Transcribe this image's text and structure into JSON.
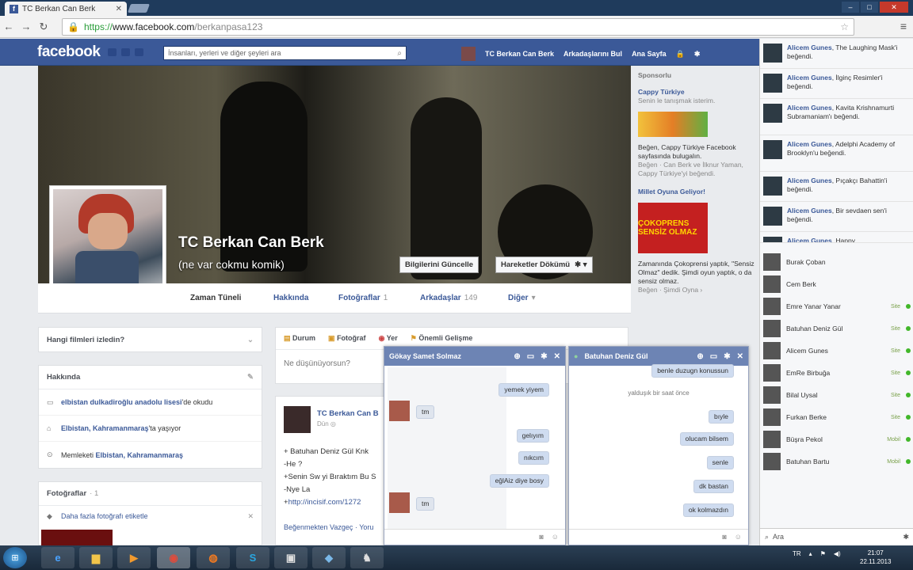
{
  "browser": {
    "tab_title": "TC Berkan Can Berk",
    "tab_close": "✕",
    "favicon": "f",
    "url_scheme": "https://",
    "url_domain": "www.facebook.com",
    "url_path": "/berkanpasa123"
  },
  "fb": {
    "logo": "facebook",
    "search_placeholder": "İnsanları, yerleri ve diğer şeyleri ara",
    "nav": {
      "profile_name": "TC Berkan Can Berk",
      "find_friends": "Arkadaşlarını Bul",
      "home": "Ana Sayfa"
    }
  },
  "profile": {
    "name": "TC Berkan Can Berk",
    "bio": "(ne var cokmu komik)",
    "buttons": {
      "update_info": "Bilgilerini Güncelle",
      "activity_log": "Hareketler Dökümü"
    },
    "tabs": [
      {
        "label": "Zaman Tüneli",
        "count": ""
      },
      {
        "label": "Hakkında",
        "count": ""
      },
      {
        "label": "Fotoğraflar",
        "count": "1"
      },
      {
        "label": "Arkadaşlar",
        "count": "149"
      },
      {
        "label": "Diğer",
        "count": "▾"
      }
    ]
  },
  "left": {
    "films_question": "Hangi filmleri izledin?",
    "about_title": "Hakkında",
    "about": {
      "school_link": "elbistan dulkadiroğlu anadolu lisesi",
      "school_suffix": "'de okudu",
      "lives_link": "Elbistan, Kahramanmaraş",
      "lives_suffix": "'ta yaşıyor",
      "from_prefix": "Memleketi ",
      "from_link": "Elbistan, Kahramanmaraş"
    },
    "photos_title": "Fotoğraflar",
    "photos_count": "· 1",
    "tag_more": "Daha fazla fotoğrafı etiketle"
  },
  "composer": {
    "status": "Durum",
    "photo": "Fotoğraf",
    "place": "Yer",
    "life_event": "Önemli Gelişme",
    "placeholder": "Ne düşünüyorsun?"
  },
  "post": {
    "author": "TC Berkan Can B",
    "date": "Dün",
    "line1": "+ Batuhan Deniz Gül Knk",
    "line2": "-He ?",
    "line3": "+Senin Sw yi Bıraktım Bu S",
    "line4": "-Nye La",
    "line5_prefix": "+",
    "line5_link": "http://incisif.com/1272",
    "footer": "Beğenmekten Vazgeç · Yoru"
  },
  "ads": {
    "header": "Sponsorlu",
    "ad1_title": "Cappy Türkiye",
    "ad1_sub": "Senin le tanışmak isterim.",
    "ad1_text": "Beğen, Cappy Türkiye Facebook sayfasında bulugalın.",
    "ad1_like": "Beğen · Can Berk ve İlknur Yaman, Cappy Türkiye'yi beğendi.",
    "ad2_title": "Millet Oyuna Geliyor!",
    "ad2_img_text": "ÇOKOPRENS SENSİZ OLMAZ",
    "ad2_text": "Zamanında Çokoprensi yaptık, \"Sensiz Olmaz\" dedik. Şimdi oyun yaptık, o da sensiz olmaz.",
    "ad2_like": "Beğen · Şimdi Oyna ›"
  },
  "ticker": [
    {
      "name": "Alicem Gunes",
      "text": ", The Laughing Mask'i beğendi."
    },
    {
      "name": "Alicem Gunes",
      "text": ", İlginç Resimler'i beğendi."
    },
    {
      "name": "Alicem Gunes",
      "text": ", Kavita Krishnamurti Subramaniam'ı beğendi."
    },
    {
      "name": "Alicem Gunes",
      "text": ", Adelphi Academy of Brooklyn'u beğendi."
    },
    {
      "name": "Alicem Gunes",
      "text": ", Pıçakçı Bahattin'i beğendi."
    },
    {
      "name": "Alicem Gunes",
      "text": ", Bir sevdaen sen'i beğendi."
    },
    {
      "name": "Alicem Gunes",
      "text": ", Happy"
    }
  ],
  "chat_list": [
    {
      "name": "Burak Çoban",
      "status": ""
    },
    {
      "name": "Cem Berk",
      "status": ""
    },
    {
      "name": "Emre Yanar Yanar",
      "status": "Site"
    },
    {
      "name": "Batuhan Deniz Gül",
      "status": "Site"
    },
    {
      "name": "Alicem Gunes",
      "status": "Site"
    },
    {
      "name": "EmRe Birbuğa",
      "status": "Site"
    },
    {
      "name": "Bilal Uysal",
      "status": "Site"
    },
    {
      "name": "Furkan Berke",
      "status": "Site"
    },
    {
      "name": "Büşra Pekol",
      "status": "Mobil"
    },
    {
      "name": "Batuhan Bartu",
      "status": "Mobil"
    }
  ],
  "chat_search": "Ara",
  "chat1": {
    "title": "Gökay Samet Solmaz",
    "messages": [
      {
        "text": "yemek yiyem",
        "dir": "out"
      },
      {
        "text": "tm",
        "dir": "in"
      },
      {
        "text": "gelıyım",
        "dir": "out"
      },
      {
        "text": "nıkcım",
        "dir": "out"
      },
      {
        "text": "eğlAiz diye bosy",
        "dir": "out"
      },
      {
        "text": "tm",
        "dir": "in"
      }
    ]
  },
  "chat2": {
    "title": "Batuhan Deniz Gül",
    "messages": [
      {
        "text": "benle duzugn konussun",
        "dir": "out"
      },
      {
        "text": "yalduşık bir saat önce",
        "dir": "sep"
      },
      {
        "text": "bıyle",
        "dir": "out"
      },
      {
        "text": "olucam bilsem",
        "dir": "out"
      },
      {
        "text": "senle",
        "dir": "out"
      },
      {
        "text": "dk bastan",
        "dir": "out"
      },
      {
        "text": "ok kolmazdın",
        "dir": "out"
      }
    ]
  },
  "taskbar": {
    "lang": "TR",
    "time": "21:07",
    "date": "22.11.2013"
  }
}
